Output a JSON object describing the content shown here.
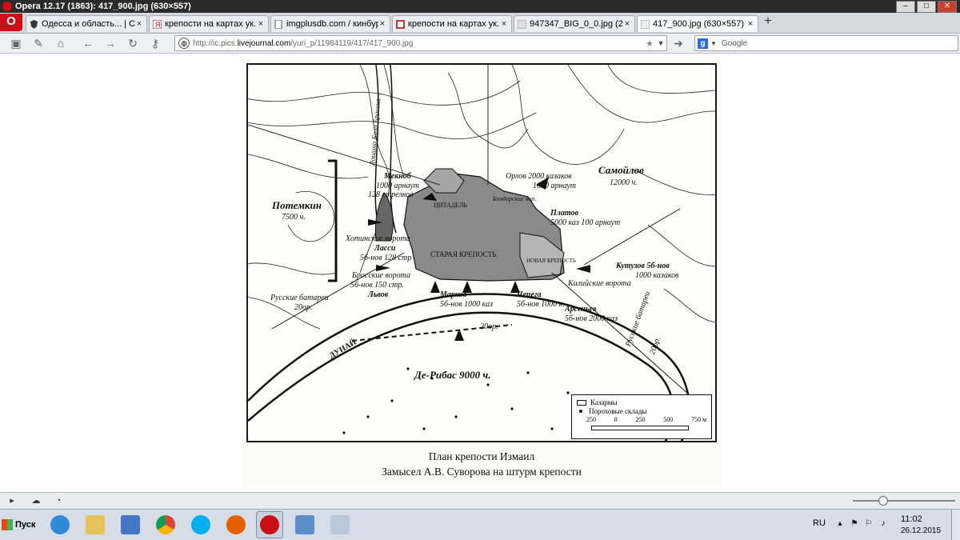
{
  "window": {
    "title": "Opera 12.17 (1863): 417_900.jpg (630×557)",
    "controls": {
      "minimize": "–",
      "maximize": "□",
      "close": "✕"
    }
  },
  "menu_button": {
    "label": "O"
  },
  "tabs": [
    {
      "label": "Одесса и область... | С...",
      "close": "×",
      "icon": "shield-icon"
    },
    {
      "label": "крепости на картах ук...",
      "close": "×",
      "icon": "yandex-icon"
    },
    {
      "label": "imgplusdb.com / кинбур...",
      "close": "×",
      "icon": "page-icon"
    },
    {
      "label": "крепости на картах ук...",
      "close": "×",
      "icon": "image-icon"
    },
    {
      "label": "947347_BIG_0_0.jpg (2...",
      "close": "×",
      "icon": "image-icon"
    },
    {
      "label": "417_900.jpg (630×557)",
      "close": "×",
      "icon": "image-icon",
      "active": true
    }
  ],
  "new_tab": "+",
  "toolbar": {
    "address": {
      "prefix": "http://ic.pics.",
      "domain": "livejournal.com",
      "path": "/yuri_p/11984119/417/417_900.jpg"
    },
    "search": {
      "engine": "g",
      "placeholder": "Google"
    }
  },
  "image": {
    "caption_line1": "План крепости Измаил",
    "caption_line2": "Замысел А.В. Суворова на штурм крепости"
  },
  "map_labels": {
    "potemkin": "Потемкин",
    "potemkin_count": "7500 ч.",
    "meknob": "Мекноб",
    "meknob_line2": "1000 арнаут",
    "meknob_line3": "128 стрелков",
    "citadel": "ЦИТАДЕЛЬ",
    "orlov": "Орлов 2000 казаков",
    "orlov_line2": "1000 арнаут",
    "samoilov": "Самойлов",
    "samoilov_count": "12000 ч.",
    "bender_gate": "Бендерские вор.",
    "platov": "Платов",
    "platov_line2": "5000 каз 100 арнаут",
    "khotin_gate": "Хотинские ворота",
    "lassi": "Ласси",
    "lassi_line2": "5б-нов 128 стр",
    "old_fortress": "СТАРАЯ КРЕПОСТЬ",
    "new_fortress": "НОВАЯ КРЕПОСТЬ",
    "kutuzov": "Кутузов 5б-нов",
    "kutuzov_line2": "1000 казаков",
    "kiliya_gate": "Килийские ворота",
    "bros_gate": "Бросские ворота",
    "bros_line2": "5б-нов 150 стр.",
    "lvov": "Львов",
    "russian_batteries_left": "Русские батареи",
    "batteries_left_count": "20ор.",
    "markov": "Марков",
    "markov_line2": "5б-нов 1000 каз",
    "chepega": "Чепега",
    "chepega_line2": "5б-нов 1000 к.",
    "arsenyev": "Арсеньев",
    "arsenyev_line2": "5б-нов 2000 каз",
    "ships_count": "20ор.",
    "danube": "ДУНАЙ",
    "deribas": "Де-Рибас 9000 ч.",
    "russian_batteries_right": "Русские батареи",
    "batteries_right_count": "20ор.",
    "hollow": "Лощина Бала Бросска"
  },
  "legend": {
    "barracks": "Казармы",
    "powder": "Пороховые склады",
    "scale_ticks": [
      "250",
      "0",
      "250",
      "500",
      "750 м"
    ]
  },
  "taskbar": {
    "start_label": "Пуск",
    "lang": "RU",
    "time": "11:02",
    "date": "26.12.2015"
  }
}
